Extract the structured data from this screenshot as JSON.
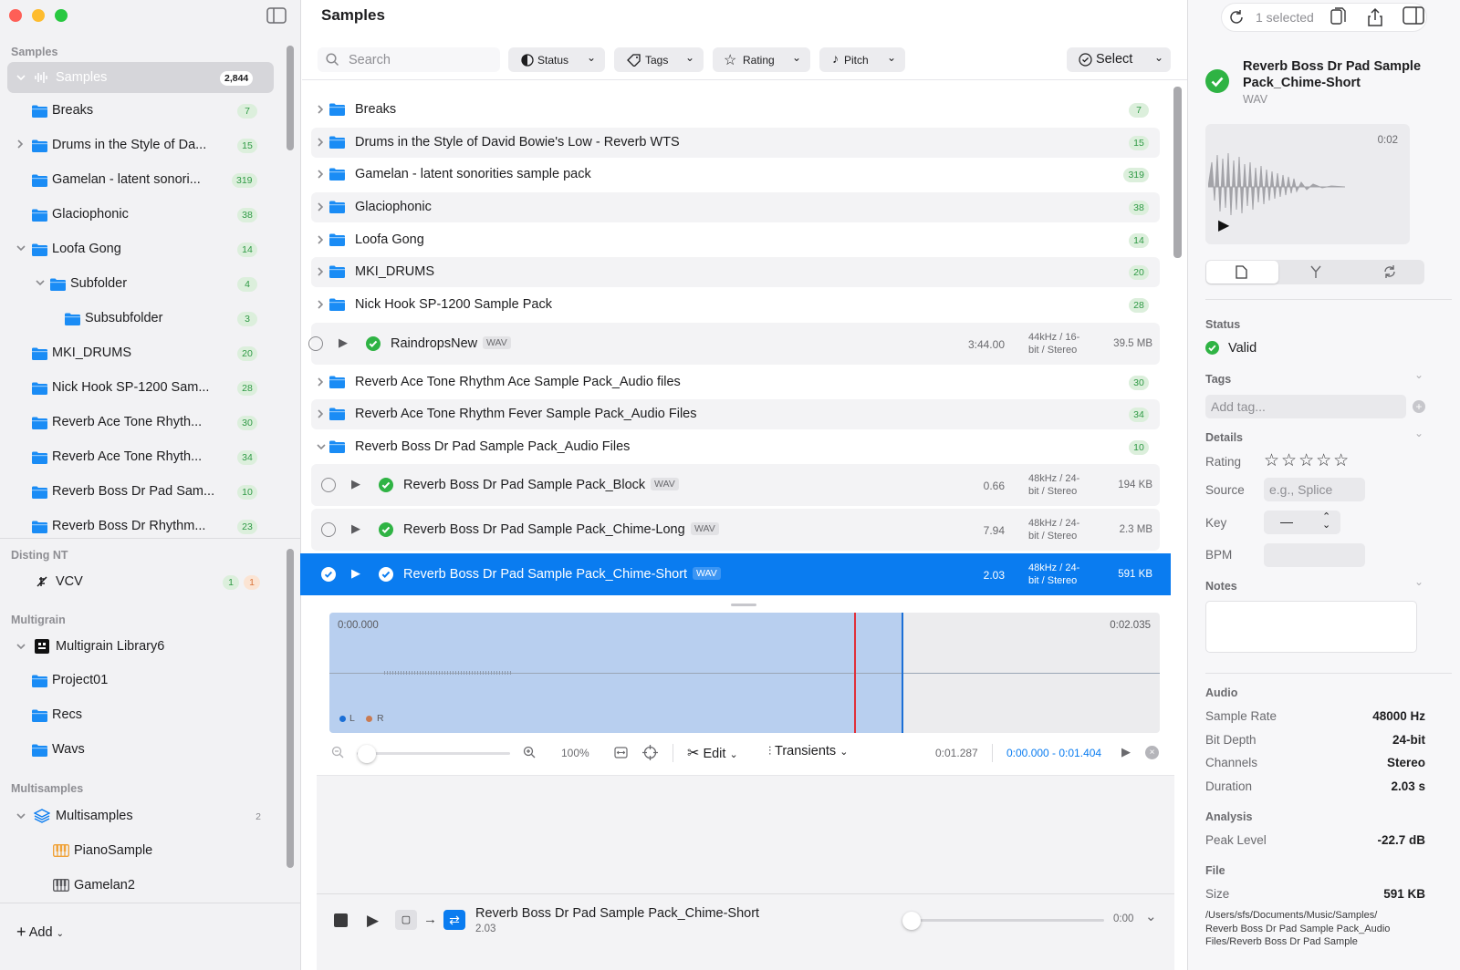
{
  "sidebar": {
    "sections": {
      "samples": "Samples",
      "disting": "Disting NT",
      "multigrain": "Multigrain",
      "multisamples": "Multisamples"
    },
    "samples_root": {
      "label": "Samples",
      "count": "2,844"
    },
    "items": [
      {
        "label": "Breaks",
        "count": "7"
      },
      {
        "label": "Drums in the Style of Da...",
        "count": "15"
      },
      {
        "label": "Gamelan - latent sonori...",
        "count": "319"
      },
      {
        "label": "Glaciophonic",
        "count": "38"
      },
      {
        "label": "Loofa Gong",
        "count": "14"
      },
      {
        "label": "Subfolder",
        "count": "4"
      },
      {
        "label": "Subsubfolder",
        "count": "3"
      },
      {
        "label": "MKI_DRUMS",
        "count": "20"
      },
      {
        "label": "Nick Hook SP-1200 Sam...",
        "count": "28"
      },
      {
        "label": "Reverb Ace Tone Rhyth...",
        "count": "30"
      },
      {
        "label": "Reverb Ace Tone Rhyth...",
        "count": "34"
      },
      {
        "label": "Reverb Boss Dr Pad Sam...",
        "count": "10"
      },
      {
        "label": "Reverb Boss Dr Rhythm...",
        "count": "23"
      }
    ],
    "disting": {
      "label": "VCV",
      "count_a": "1",
      "count_b": "1"
    },
    "multigrain": {
      "library": "Multigrain Library6",
      "items": [
        "Project01",
        "Recs",
        "Wavs"
      ]
    },
    "multisamples": {
      "label": "Multisamples",
      "count": "2",
      "items": [
        "PianoSample",
        "Gamelan2"
      ]
    },
    "add_label": "Add"
  },
  "main": {
    "title": "Samples",
    "search_placeholder": "Search",
    "filters": {
      "status": "Status",
      "tags": "Tags",
      "rating": "Rating",
      "pitch": "Pitch",
      "select": "Select"
    },
    "folders_top": [
      {
        "label": "Breaks",
        "count": "7"
      },
      {
        "label": "Drums in the Style of David Bowie's Low - Reverb WTS",
        "count": "15"
      },
      {
        "label": "Gamelan - latent sonorities sample pack",
        "count": "319"
      },
      {
        "label": "Glaciophonic",
        "count": "38"
      },
      {
        "label": "Loofa Gong",
        "count": "14"
      },
      {
        "label": "MKI_DRUMS",
        "count": "20"
      },
      {
        "label": "Nick Hook SP-1200 Sample Pack",
        "count": "28"
      }
    ],
    "raindrops": {
      "name": "RaindropsNew",
      "type": "WAV",
      "duration": "3:44.00",
      "format_a": "44kHz / 16-",
      "format_b": "bit / Stereo",
      "size": "39.5 MB"
    },
    "folders_mid": [
      {
        "label": "Reverb Ace Tone Rhythm Ace Sample Pack_Audio files",
        "count": "30"
      },
      {
        "label": "Reverb Ace Tone Rhythm Fever Sample Pack_Audio Files",
        "count": "34"
      },
      {
        "label": "Reverb Boss Dr Pad Sample Pack_Audio Files",
        "count": "10"
      }
    ],
    "samples": [
      {
        "name": "Reverb Boss Dr Pad Sample Pack_Block",
        "type": "WAV",
        "duration": "0.66",
        "format_a": "48kHz / 24-",
        "format_b": "bit / Stereo",
        "size": "194 KB"
      },
      {
        "name": "Reverb Boss Dr Pad Sample Pack_Chime-Long",
        "type": "WAV",
        "duration": "7.94",
        "format_a": "48kHz / 24-",
        "format_b": "bit / Stereo",
        "size": "2.3 MB"
      },
      {
        "name": "Reverb Boss Dr Pad Sample Pack_Chime-Short",
        "type": "WAV",
        "duration": "2.03",
        "format_a": "48kHz / 24-",
        "format_b": "bit / Stereo",
        "size": "591 KB"
      }
    ],
    "editor": {
      "start": "0:00.000",
      "end": "0:02.035",
      "ch_l": "L",
      "ch_r": "R",
      "zoom": "100%",
      "edit": "Edit",
      "transients": "Transients",
      "position": "0:01.287",
      "range": "0:00.000 - 0:01.404"
    },
    "player": {
      "title": "Reverb Boss Dr Pad Sample Pack_Chime-Short",
      "sub": "2.03",
      "time": "0:00"
    }
  },
  "inspector": {
    "selected": "1 selected",
    "name": "Reverb Boss Dr Pad Sample Pack_Chime-Short",
    "type": "WAV",
    "preview_time": "0:02",
    "status_h": "Status",
    "status": "Valid",
    "tags_h": "Tags",
    "tag_placeholder": "Add tag...",
    "details_h": "Details",
    "rating_k": "Rating",
    "source_k": "Source",
    "source_placeholder": "e.g., Splice",
    "key_k": "Key",
    "key_v": "—",
    "bpm_k": "BPM",
    "notes_h": "Notes",
    "audio_h": "Audio",
    "audio": [
      {
        "k": "Sample Rate",
        "v": "48000 Hz"
      },
      {
        "k": "Bit Depth",
        "v": "24-bit"
      },
      {
        "k": "Channels",
        "v": "Stereo"
      },
      {
        "k": "Duration",
        "v": "2.03 s"
      }
    ],
    "analysis_h": "Analysis",
    "peak_k": "Peak Level",
    "peak_v": "-22.7 dB",
    "file_h": "File",
    "size_k": "Size",
    "size_v": "591 KB",
    "path": [
      "/Users/sfs/Documents/Music/Samples/",
      "Reverb Boss Dr Pad Sample Pack_Audio",
      "Files/Reverb Boss Dr Pad Sample"
    ]
  },
  "colors": {
    "accent": "#0a7cf0",
    "valid": "#2fb344",
    "badge_bg": "#dcefdc",
    "playhead": "#e0303a"
  }
}
